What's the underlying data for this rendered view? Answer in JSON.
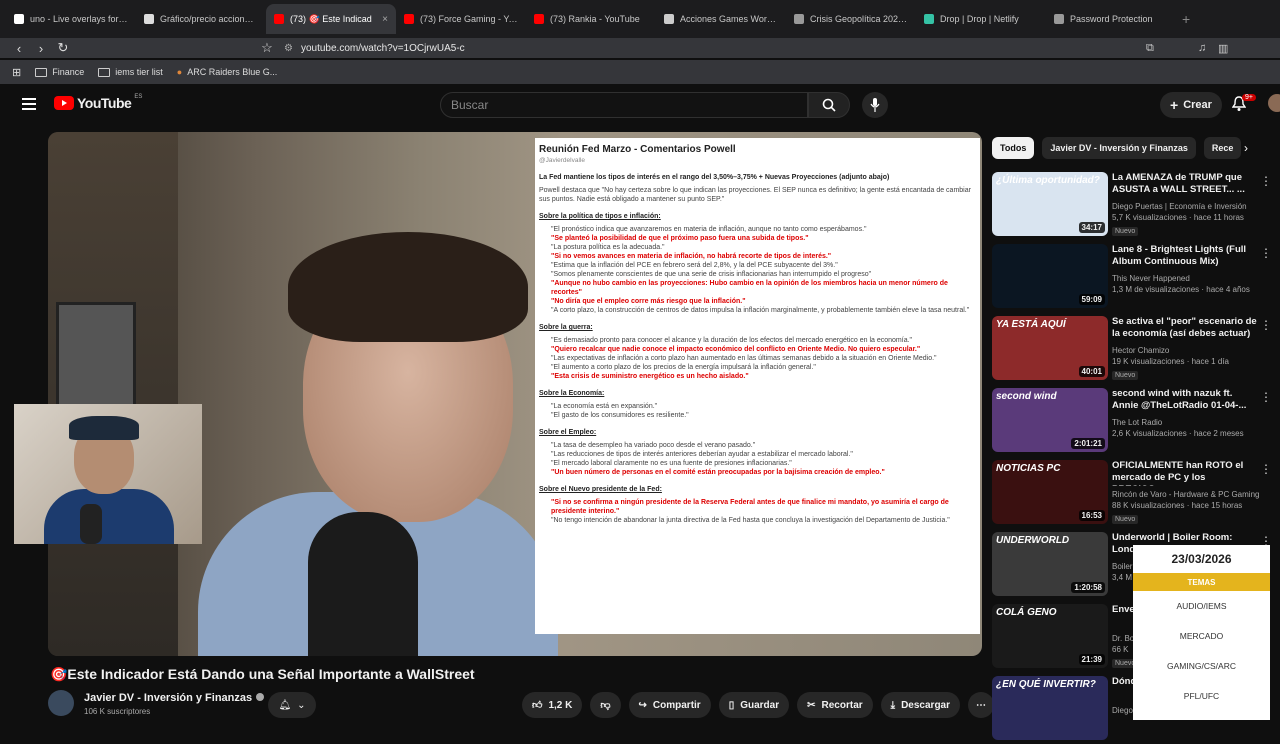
{
  "browser": {
    "tabs": [
      {
        "title": "uno - Live overlays for str",
        "color": "#ffffff",
        "active": false
      },
      {
        "title": "Gráfico/precio acciones LI",
        "color": "#dddddd",
        "active": false
      },
      {
        "title": "(73) 🎯 Este Indicad",
        "color": "#ff0000",
        "active": true
      },
      {
        "title": "(73) Force Gaming - YouTu",
        "color": "#ff0000",
        "active": false
      },
      {
        "title": "(73) Rankia - YouTube",
        "color": "#ff0000",
        "active": false
      },
      {
        "title": "Acciones Games Worksho",
        "color": "#cccccc",
        "active": false
      },
      {
        "title": "Crisis Geopolítica 2026 —",
        "color": "#999999",
        "active": false
      },
      {
        "title": "Drop | Drop | Netlify",
        "color": "#35c2a5",
        "active": false
      },
      {
        "title": "Password Protection",
        "color": "#999999",
        "active": false
      }
    ],
    "url": "youtube.com/watch?v=1OCjrwUA5-c",
    "bookmarks": [
      "Finance",
      "iems tier list",
      "ARC Raiders Blue G..."
    ]
  },
  "header": {
    "logo": "YouTube",
    "country": "ES",
    "search_placeholder": "Buscar",
    "create_label": "Crear",
    "notif_count": "9+"
  },
  "document": {
    "title": "Reunión Fed Marzo - Comentarios Powell",
    "handle": "@Javierdelvalle",
    "lead": "La Fed mantiene los tipos de interés en el rango del 3,50%–3,75% + Nuevas Proyecciones (adjunto abajo)",
    "quote": "Powell destaca que \"No hay certeza sobre lo que indican las proyecciones. El SEP nunca es definitivo; la gente está encantada de cambiar sus puntos. Nadie está obligado a mantener su punto SEP.\"",
    "sections": [
      {
        "heading": "Sobre la política de tipos e inflación:",
        "lines": [
          {
            "t": "\"El pronóstico indica que avanzaremos en materia de inflación, aunque no tanto como esperábamos.\"",
            "red": false
          },
          {
            "t": "\"Se planteó la posibilidad de que el próximo paso fuera una subida de tipos.\"",
            "red": true
          },
          {
            "t": "\"La postura política es la adecuada.\"",
            "red": false
          },
          {
            "t": "\"Si no vemos avances en materia de inflación, no habrá recorte de tipos de interés.\"",
            "red": true
          },
          {
            "t": "\"Estima que la inflación del PCE en febrero será del 2,8%, y la del PCE subyacente del 3%.\"",
            "red": false
          },
          {
            "t": "\"Somos plenamente conscientes de que una serie de crisis inflacionarias han interrumpido el progreso\"",
            "red": false
          },
          {
            "t": "\"Aunque no hubo cambio en las proyecciones: Hubo cambio en la opinión de los miembros hacia un menor número de recortes\"",
            "red": true
          },
          {
            "t": "\"No diría que el empleo corre más riesgo que la inflación.\"",
            "red": true
          },
          {
            "t": "\"A corto plazo, la construcción de centros de datos impulsa la inflación marginalmente, y probablemente también eleve la tasa neutral.\"",
            "red": false
          }
        ]
      },
      {
        "heading": "Sobre la guerra:",
        "lines": [
          {
            "t": "\"Es demasiado pronto para conocer el alcance y la duración de los efectos del mercado energético en la economía.\"",
            "red": false
          },
          {
            "t": "\"Quiero recalcar que nadie conoce el impacto económico del conflicto en Oriente Medio. No quiero especular.\"",
            "red": true
          },
          {
            "t": "\"Las expectativas de inflación a corto plazo han aumentado en las últimas semanas debido a la situación en Oriente Medio.\"",
            "red": false
          },
          {
            "t": "\"El aumento a corto plazo de los precios de la energía impulsará la inflación general.\"",
            "red": false
          },
          {
            "t": "\"Esta crisis de suministro energético es un hecho aislado.\"",
            "red": true
          }
        ]
      },
      {
        "heading": "Sobre la Economía:",
        "lines": [
          {
            "t": "\"La economía está en expansión.\"",
            "red": false
          },
          {
            "t": "\"El gasto de los consumidores es resiliente.\"",
            "red": false
          }
        ]
      },
      {
        "heading": "Sobre el Empleo:",
        "lines": [
          {
            "t": "\"La tasa de desempleo ha variado poco desde el verano pasado.\"",
            "red": false
          },
          {
            "t": "\"Las reducciones de tipos de interés anteriores deberían ayudar a estabilizar el mercado laboral.\"",
            "red": false
          },
          {
            "t": "\"El mercado laboral claramente no es una fuente de presiones inflacionarias.\"",
            "red": false
          },
          {
            "t": "\"Un buen número de personas en el comité están preocupadas por la bajísima creación de empleo.\"",
            "red": true
          }
        ]
      },
      {
        "heading": "Sobre el Nuevo presidente de la Fed:",
        "lines": [
          {
            "t": "\"Si no se confirma a ningún presidente de la Reserva Federal antes de que finalice mi mandato, yo asumiría el cargo de presidente interino.\"",
            "red": true
          },
          {
            "t": "\"No tengo intención de abandonar la junta directiva de la Fed hasta que concluya la investigación del Departamento de Justicia.\"",
            "red": false
          }
        ]
      }
    ]
  },
  "video": {
    "title": "🎯Este Indicador Está Dando una Señal Importante a WallStreet",
    "channel": "Javier DV - Inversión y Finanzas",
    "subs": "106 K suscriptores",
    "likes": "1,2 K",
    "share": "Compartir",
    "save": "Guardar",
    "clip": "Recortar",
    "download": "Descargar"
  },
  "chips": [
    "Todos",
    "Javier DV - Inversión y Finanzas",
    "Rece"
  ],
  "recs": [
    {
      "title": "La AMENAZA de TRUMP que ASUSTA a WALL STREET... ...",
      "channel": "Diego Puertas | Economía e Inversión",
      "meta": "5,7 K visualizaciones · hace 11 horas",
      "dur": "34:17",
      "new": "Nuevo",
      "thumb_text": "¿Última oportunidad?",
      "bg": "#d9e4f0"
    },
    {
      "title": "Lane 8 - Brightest Lights (Full Album Continuous Mix)",
      "channel": "This Never Happened",
      "meta": "1,3 M de visualizaciones · hace 4 años",
      "dur": "59:09",
      "new": "",
      "thumb_text": "",
      "bg": "#0b1622"
    },
    {
      "title": "Se activa el \"peor\" escenario de la economía (así debes actuar)",
      "channel": "Hector Chamizo",
      "meta": "19 K visualizaciones · hace 1 día",
      "dur": "40:01",
      "new": "Nuevo",
      "thumb_text": "YA ESTÁ AQUÍ",
      "bg": "#8d2a2a"
    },
    {
      "title": "second wind with nazuk ft. Annie @TheLotRadio 01-04-...",
      "channel": "The Lot Radio",
      "meta": "2,6 K visualizaciones · hace 2 meses",
      "dur": "2:01:21",
      "new": "",
      "thumb_text": "second wind",
      "bg": "#5a3a7a"
    },
    {
      "title": "OFICIALMENTE han ROTO el mercado de PC y los PRECIOS...",
      "channel": "Rincón de Varo - Hardware & PC Gaming",
      "meta": "88 K visualizaciones · hace 15 horas",
      "dur": "16:53",
      "new": "Nuevo",
      "thumb_text": "NOTICIAS PC",
      "bg": "#3a1010"
    },
    {
      "title": "Underworld | Boiler Room: London",
      "channel": "Boiler Room",
      "meta": "3,4 M",
      "dur": "1:20:58",
      "new": "",
      "thumb_text": "UNDERWORLD",
      "bg": "#3a3a3a"
    },
    {
      "title": "Envejecimiento Colásico",
      "channel": "Dr. Bo",
      "meta": "66 K",
      "dur": "21:39",
      "new": "Nuevo",
      "thumb_text": "COLÁ GENO",
      "bg": "#1a1a1a"
    },
    {
      "title": "Dónde invertir cons...",
      "channel": "Diego Puertas | Economía e Inversión",
      "meta": "",
      "dur": "",
      "new": "",
      "thumb_text": "¿EN QUÉ INVERTIR?",
      "bg": "#2a2a5a"
    }
  ],
  "overlay": {
    "date": "23/03/2026",
    "header": "TEMAS",
    "items": [
      "AUDIO/IEMS",
      "MERCADO",
      "GAMING/CS/ARC",
      "PFL/UFC"
    ]
  }
}
